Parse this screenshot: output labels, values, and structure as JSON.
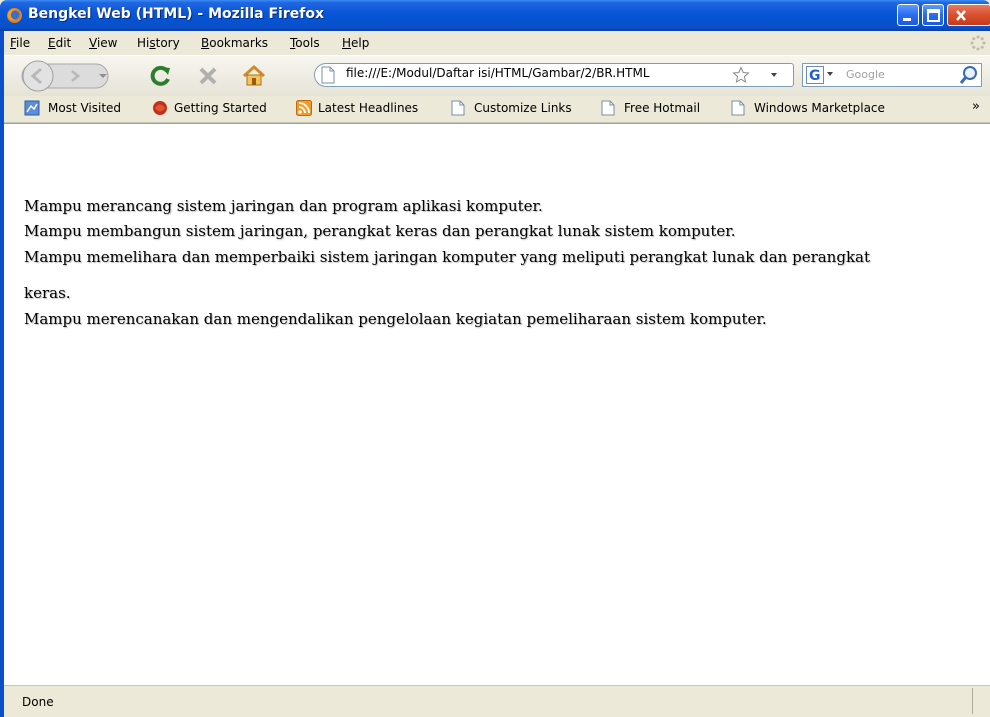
{
  "window": {
    "title": "Bengkel Web (HTML) - Mozilla Firefox",
    "title_color": "#0554D4"
  },
  "menu": {
    "items": [
      {
        "pre": "",
        "acc": "F",
        "post": "ile"
      },
      {
        "pre": "",
        "acc": "E",
        "post": "dit"
      },
      {
        "pre": "",
        "acc": "V",
        "post": "iew"
      },
      {
        "pre": "Hi",
        "acc": "s",
        "post": "tory"
      },
      {
        "pre": "",
        "acc": "B",
        "post": "ookmarks"
      },
      {
        "pre": "",
        "acc": "T",
        "post": "ools"
      },
      {
        "pre": "",
        "acc": "H",
        "post": "elp"
      }
    ]
  },
  "nav": {
    "url": "file:///E:/Modul/Daftar isi/HTML/Gambar/2/BR.HTML",
    "search_placeholder": "Google",
    "icons": [
      "back-icon",
      "forward-icon",
      "reload-icon",
      "stop-icon",
      "home-icon",
      "page-icon",
      "star-icon",
      "google-icon",
      "search-icon"
    ]
  },
  "bookmarks": {
    "items": [
      {
        "label": "Most Visited",
        "icon": "most-visited-icon"
      },
      {
        "label": "Getting Started",
        "icon": "getting-started-icon"
      },
      {
        "label": "Latest Headlines",
        "icon": "rss-icon"
      },
      {
        "label": "Customize Links",
        "icon": "page-icon"
      },
      {
        "label": "Free Hotmail",
        "icon": "page-icon"
      },
      {
        "label": "Windows Marketplace",
        "icon": "page-icon"
      }
    ],
    "overflow": "»"
  },
  "content": {
    "lines": [
      "Mampu merancang sistem jaringan dan program aplikasi komputer.",
      "Mampu membangun sistem jaringan, perangkat keras dan perangkat lunak sistem komputer.",
      "Mampu memelihara dan memperbaiki sistem jaringan komputer yang meliputi perangkat lunak dan perangkat",
      "keras.",
      "Mampu merencanakan dan mengendalikan pengelolaan kegiatan pemeliharaan sistem komputer."
    ]
  },
  "status": {
    "text": "Done"
  }
}
